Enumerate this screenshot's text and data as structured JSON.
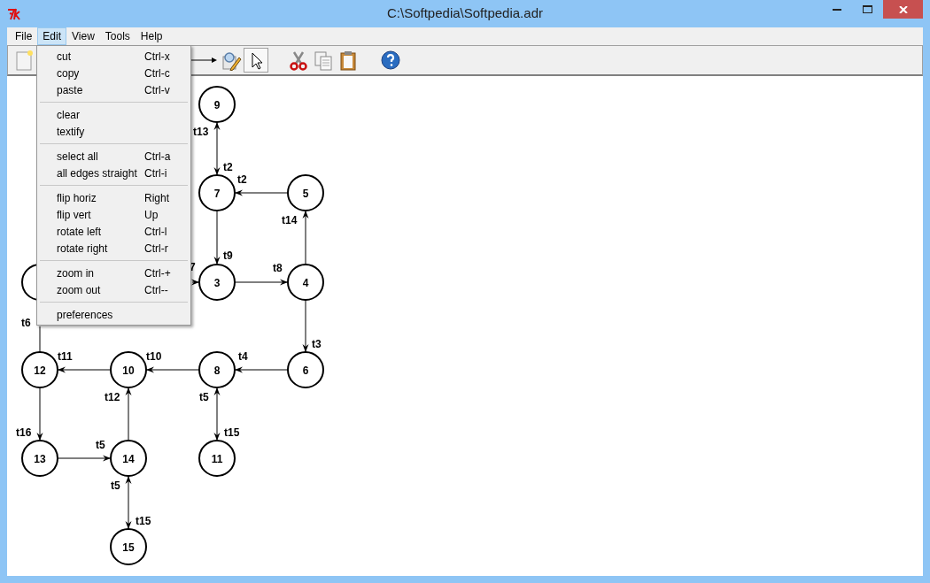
{
  "window": {
    "title": "C:\\Softpedia\\Softpedia.adr"
  },
  "menubar": [
    {
      "label": "File",
      "selected": false
    },
    {
      "label": "Edit",
      "selected": true
    },
    {
      "label": "View",
      "selected": false
    },
    {
      "label": "Tools",
      "selected": false
    },
    {
      "label": "Help",
      "selected": false
    }
  ],
  "toolbar": [
    {
      "kind": "new",
      "selected": false
    },
    {
      "kind": "edge",
      "selected": false
    },
    {
      "kind": "edit",
      "selected": false
    },
    {
      "kind": "pointer",
      "selected": true
    },
    {
      "kind": "cut",
      "selected": false
    },
    {
      "kind": "copy",
      "selected": false
    },
    {
      "kind": "paste",
      "selected": false
    },
    {
      "kind": "help",
      "selected": false
    }
  ],
  "edit_menu": {
    "groups": [
      {
        "items": [
          {
            "label": "cut",
            "shortcut": "Ctrl-x"
          },
          {
            "label": "copy",
            "shortcut": "Ctrl-c"
          },
          {
            "label": "paste",
            "shortcut": "Ctrl-v"
          }
        ]
      },
      {
        "items": [
          {
            "label": "clear"
          },
          {
            "label": "textify"
          }
        ]
      },
      {
        "items": [
          {
            "label": "select all",
            "shortcut": "Ctrl-a"
          },
          {
            "label": "all edges straight",
            "shortcut": "Ctrl-i"
          }
        ]
      },
      {
        "items": [
          {
            "label": "flip horiz",
            "shortcut": "Right"
          },
          {
            "label": "flip vert",
            "shortcut": "Up"
          },
          {
            "label": "rotate left",
            "shortcut": "Ctrl-l"
          },
          {
            "label": "rotate right",
            "shortcut": "Ctrl-r"
          }
        ]
      },
      {
        "items": [
          {
            "label": "zoom in",
            "shortcut": "Ctrl-+"
          },
          {
            "label": "zoom out",
            "shortcut": "Ctrl--"
          }
        ]
      },
      {
        "items": [
          {
            "label": "preferences"
          }
        ]
      }
    ]
  },
  "graph": {
    "nodes": [
      {
        "kind": "labelled",
        "label": "9"
      },
      {
        "kind": "labelled",
        "label": "7"
      },
      {
        "kind": "labelled",
        "label": "5"
      },
      {
        "kind": "covered"
      },
      {
        "kind": "labelled",
        "label": "3"
      },
      {
        "kind": "labelled",
        "label": "4"
      },
      {
        "kind": "labelled",
        "label": "12"
      },
      {
        "kind": "labelled",
        "label": "10"
      },
      {
        "kind": "labelled",
        "label": "8"
      },
      {
        "kind": "labelled",
        "label": "6"
      },
      {
        "kind": "labelled",
        "label": "13"
      },
      {
        "kind": "labelled",
        "label": "14"
      },
      {
        "kind": "labelled",
        "label": "11"
      },
      {
        "kind": "labelled",
        "label": "15"
      }
    ],
    "edges": [
      {
        "kind": "two-way",
        "labels": [
          "t13",
          "t2"
        ]
      },
      {
        "kind": "one-way",
        "labels": [
          "t2"
        ]
      },
      {
        "kind": "one-way",
        "labels": [
          "t14"
        ]
      },
      {
        "kind": "one-way",
        "labels": [
          "t9"
        ]
      },
      {
        "kind": "one-way",
        "labels": [
          "7"
        ]
      },
      {
        "kind": "one-way",
        "labels": [
          "t8"
        ]
      },
      {
        "kind": "plain",
        "labels": [
          "t6"
        ]
      },
      {
        "kind": "one-way",
        "labels": [
          "t3"
        ]
      },
      {
        "kind": "one-way",
        "labels": [
          "t11"
        ]
      },
      {
        "kind": "one-way",
        "labels": [
          "t10"
        ]
      },
      {
        "kind": "one-way",
        "labels": [
          "t4"
        ]
      },
      {
        "kind": "one-way",
        "labels": [
          "t16"
        ]
      },
      {
        "kind": "one-way",
        "labels": [
          "t12"
        ]
      },
      {
        "kind": "two-way",
        "labels": [
          "t5",
          "t15"
        ]
      },
      {
        "kind": "one-way",
        "labels": [
          "t5"
        ]
      },
      {
        "kind": "two-way",
        "labels": [
          "t5",
          "t15"
        ]
      }
    ]
  }
}
